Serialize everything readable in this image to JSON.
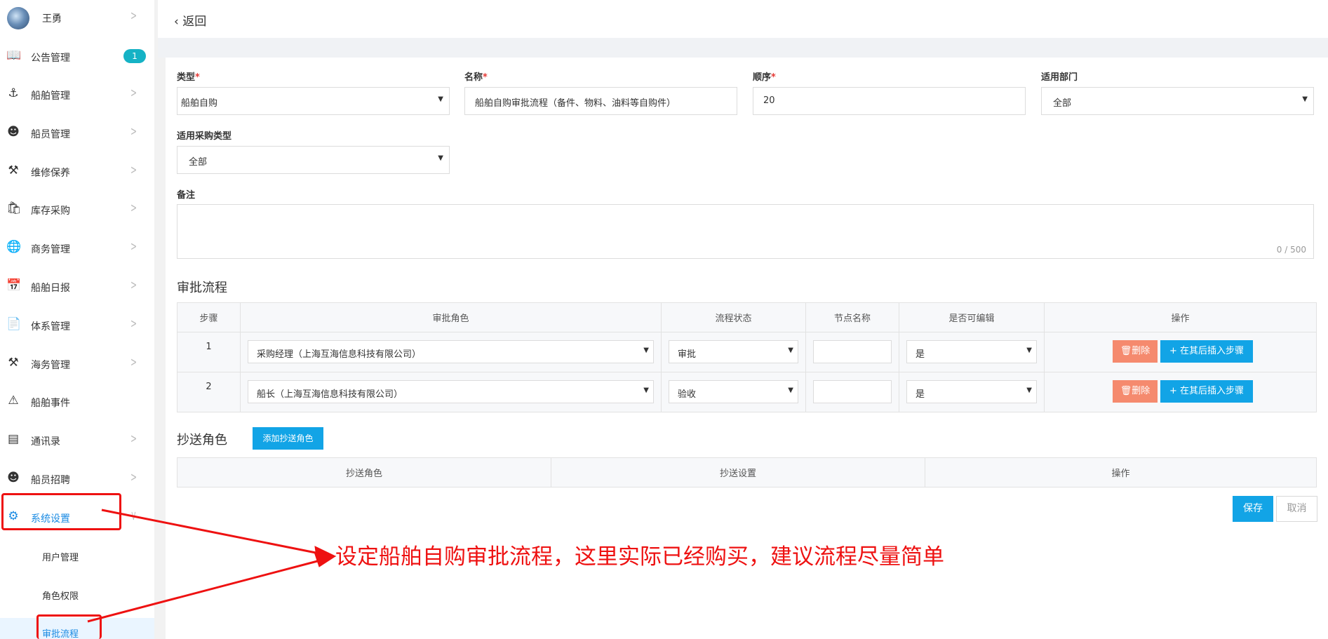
{
  "user": {
    "name": "王勇"
  },
  "nav": [
    {
      "label": "公告管理",
      "icon": "book-icon",
      "badge": "1"
    },
    {
      "label": "船舶管理",
      "icon": "anchor-icon"
    },
    {
      "label": "船员管理",
      "icon": "user-icon"
    },
    {
      "label": "维修保养",
      "icon": "hammer-icon"
    },
    {
      "label": "库存采购",
      "icon": "bag-icon"
    },
    {
      "label": "商务管理",
      "icon": "globe-icon"
    },
    {
      "label": "船舶日报",
      "icon": "calendar-icon"
    },
    {
      "label": "体系管理",
      "icon": "document-icon"
    },
    {
      "label": "海务管理",
      "icon": "signpost-icon"
    },
    {
      "label": "船舶事件",
      "icon": "warning-icon"
    },
    {
      "label": "通讯录",
      "icon": "server-icon"
    },
    {
      "label": "船员招聘",
      "icon": "user-icon"
    },
    {
      "label": "系统设置",
      "icon": "gear-icon"
    }
  ],
  "subnav": [
    {
      "label": "用户管理"
    },
    {
      "label": "角色权限"
    },
    {
      "label": "审批流程"
    }
  ],
  "topbar": {
    "back_label": "返回"
  },
  "form": {
    "type": {
      "label": "类型",
      "required": "*",
      "value": "船舶自购"
    },
    "name": {
      "label": "名称",
      "required": "*",
      "value": "船舶自购审批流程（备件、物料、油料等自购件）"
    },
    "order": {
      "label": "顺序",
      "required": "*",
      "value": "20"
    },
    "department": {
      "label": "适用部门",
      "value": "全部"
    },
    "purchase_type": {
      "label": "适用采购类型",
      "value": "全部"
    },
    "remark": {
      "label": "备注",
      "counter": "0 / 500"
    }
  },
  "approval": {
    "title": "审批流程",
    "columns": [
      "步骤",
      "审批角色",
      "流程状态",
      "节点名称",
      "是否可编辑",
      "操作"
    ],
    "rows": [
      {
        "step": "1",
        "role": "采购经理（上海互海信息科技有限公司）",
        "status": "审批",
        "node": "",
        "editable": "是"
      },
      {
        "step": "2",
        "role": "船长（上海互海信息科技有限公司）",
        "status": "验收",
        "node": "",
        "editable": "是"
      }
    ],
    "delete_label": "删除",
    "insert_label": "在其后插入步骤"
  },
  "cc": {
    "title": "抄送角色",
    "add_label": "添加抄送角色",
    "columns": [
      "抄送角色",
      "抄送设置",
      "操作"
    ]
  },
  "actions": {
    "save": "保存",
    "cancel": "取消"
  },
  "annotation": {
    "text": "设定船舶自购审批流程，这里实际已经购买，建议流程尽量简单",
    "color": "#ee1111"
  },
  "colors": {
    "accent": "#12a4e6",
    "delete": "#f58a6e",
    "badge": "#15b2c5",
    "annotation": "#ee1111"
  }
}
